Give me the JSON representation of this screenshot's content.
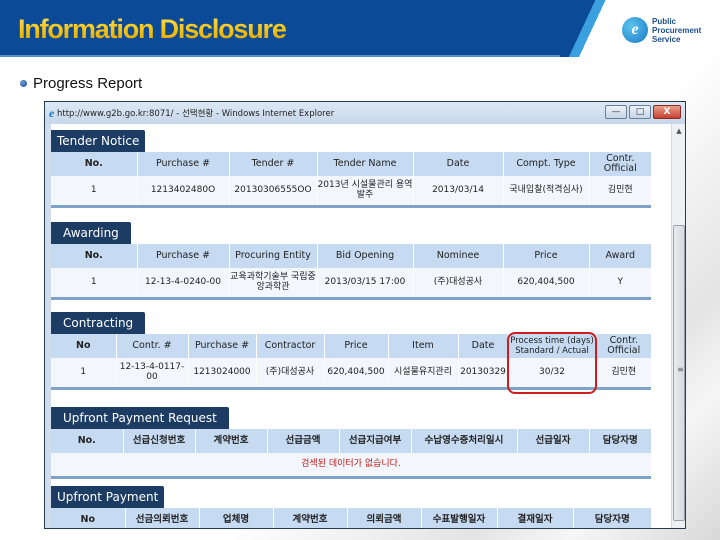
{
  "header": {
    "title": "Information Disclosure",
    "logo": {
      "mark": "e",
      "lines": [
        "Public",
        "Procurement",
        "Service"
      ]
    }
  },
  "section_heading": "Progress Report",
  "window": {
    "title": "http://www.g2b.go.kr:8071/ - 선택현황 - Windows Internet Explorer",
    "buttons": {
      "minimize": "—",
      "maximize": "□",
      "close": "X"
    },
    "scroll_up": "▲",
    "scroll_grip": "≡"
  },
  "sections": {
    "tender_notice": {
      "tab": "Tender Notice",
      "columns": [
        "No.",
        "Purchase #",
        "Tender #",
        "Tender Name",
        "Date",
        "Compt. Type",
        "Contr. Official"
      ],
      "rows": [
        [
          "1",
          "1213402480O",
          "20130306555OO",
          "2013년 시설물관리 용역 발주",
          "2013/03/14",
          "국내입찰(적격심사)",
          "김민현"
        ]
      ]
    },
    "awarding": {
      "tab": "Awarding",
      "columns": [
        "No.",
        "Purchase #",
        "Procuring Entity",
        "Bid Opening",
        "Nominee",
        "Price",
        "Award"
      ],
      "rows": [
        [
          "1",
          "12-13-4-0240-00",
          "교육과학기술부 국립중앙과학관",
          "2013/03/15 17:00",
          "(주)대성공사",
          "620,404,500",
          "Y"
        ]
      ]
    },
    "contracting": {
      "tab": "Contracting",
      "columns": [
        "No",
        "Contr. #",
        "Purchase #",
        "Contractor",
        "Price",
        "Item",
        "Date",
        "Process time (days) Standard / Actual",
        "Contr. Official"
      ],
      "rows": [
        [
          "1",
          "12-13-4-0117-00",
          "1213024000",
          "(주)대성공사",
          "620,404,500",
          "시설물유지관리",
          "20130329",
          "30/32",
          "김민현"
        ]
      ]
    },
    "upfront_request": {
      "tab": "Upfront Payment Request",
      "columns": [
        "No.",
        "선급신청번호",
        "계약번호",
        "선급금액",
        "선급지급여부",
        "수납영수증처리일시",
        "선급일자",
        "담당자명"
      ],
      "empty_message": "검색된 데이터가 없습니다."
    },
    "upfront_payment": {
      "tab": "Upfront Payment",
      "columns": [
        "No",
        "선금의뢰번호",
        "업체명",
        "계약번호",
        "의뢰금액",
        "수표발행일자",
        "결재일자",
        "담당자명"
      ]
    }
  },
  "colors": {
    "banner": "#0a4a96",
    "title_gold": "#f5c10e",
    "tab_bg": "#1c3c64",
    "header_row": "#c6dbf2",
    "highlight": "#d01c1c",
    "empty_text": "#c01818"
  }
}
